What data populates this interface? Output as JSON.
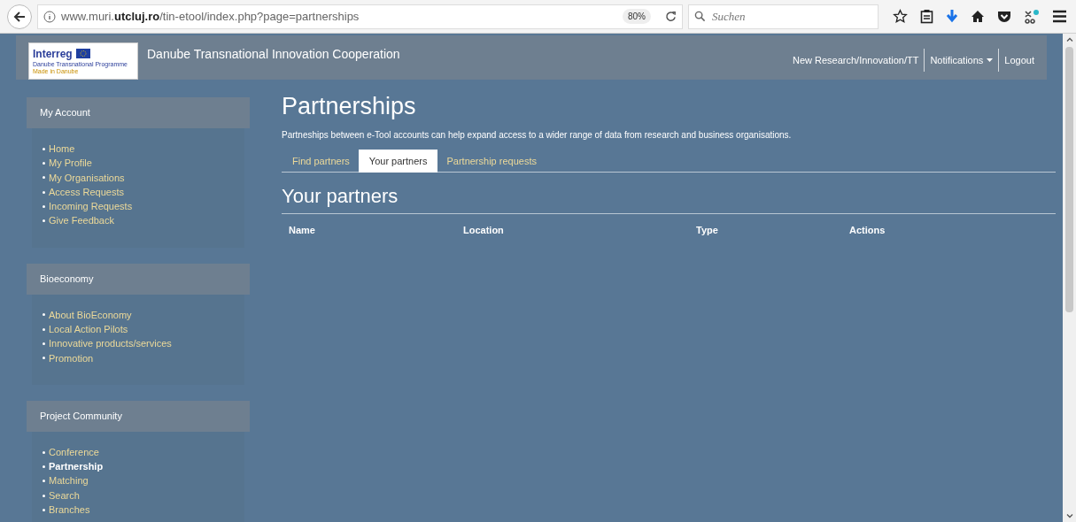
{
  "browser": {
    "url": "www.muri.**utcluj.ro**/tin-etool/index.php?page=partnerships",
    "zoom": "80%",
    "search": {
      "placeholder": "Suchen"
    }
  },
  "header": {
    "logo": {
      "name": "Interreg",
      "subtitle": "Danube Transnational Programme",
      "tagline": "Made in Danube"
    },
    "title": "Danube Transnational Innovation Cooperation",
    "nav": [
      {
        "label": "New Research/Innovation/TT",
        "kind": "link"
      },
      {
        "label": "Notifications",
        "kind": "dropdown"
      },
      {
        "label": "Logout",
        "kind": "link"
      }
    ]
  },
  "sidebar": [
    {
      "title": "My Account",
      "items": [
        {
          "label": "Home",
          "selected": false
        },
        {
          "label": "My Profile",
          "selected": false
        },
        {
          "label": "My Organisations",
          "selected": false
        },
        {
          "label": "Access Requests",
          "selected": false
        },
        {
          "label": "Incoming Requests",
          "selected": false
        },
        {
          "label": "Give Feedback",
          "selected": false
        }
      ]
    },
    {
      "title": "Bioeconomy",
      "items": [
        {
          "label": "About BioEconomy",
          "selected": false
        },
        {
          "label": "Local Action Pilots",
          "selected": false
        },
        {
          "label": "Innovative products/services",
          "selected": false
        },
        {
          "label": "Promotion",
          "selected": false
        }
      ]
    },
    {
      "title": "Project Community",
      "items": [
        {
          "label": "Conference",
          "selected": false
        },
        {
          "label": "Partnership",
          "selected": true
        },
        {
          "label": "Matching",
          "selected": false
        },
        {
          "label": "Search",
          "selected": false
        },
        {
          "label": "Branches",
          "selected": false
        }
      ]
    }
  ],
  "main": {
    "title": "Partnerships",
    "description": "Partneships between e-Tool accounts can help expand access to a wider range of data from research and business organisations.",
    "tabs": [
      {
        "label": "Find partners",
        "selected": false
      },
      {
        "label": "Your partners",
        "selected": true
      },
      {
        "label": "Partnership requests",
        "selected": false
      }
    ],
    "section_title": "Your partners",
    "table": {
      "columns": [
        "Name",
        "Location",
        "Type",
        "Actions"
      ]
    }
  }
}
